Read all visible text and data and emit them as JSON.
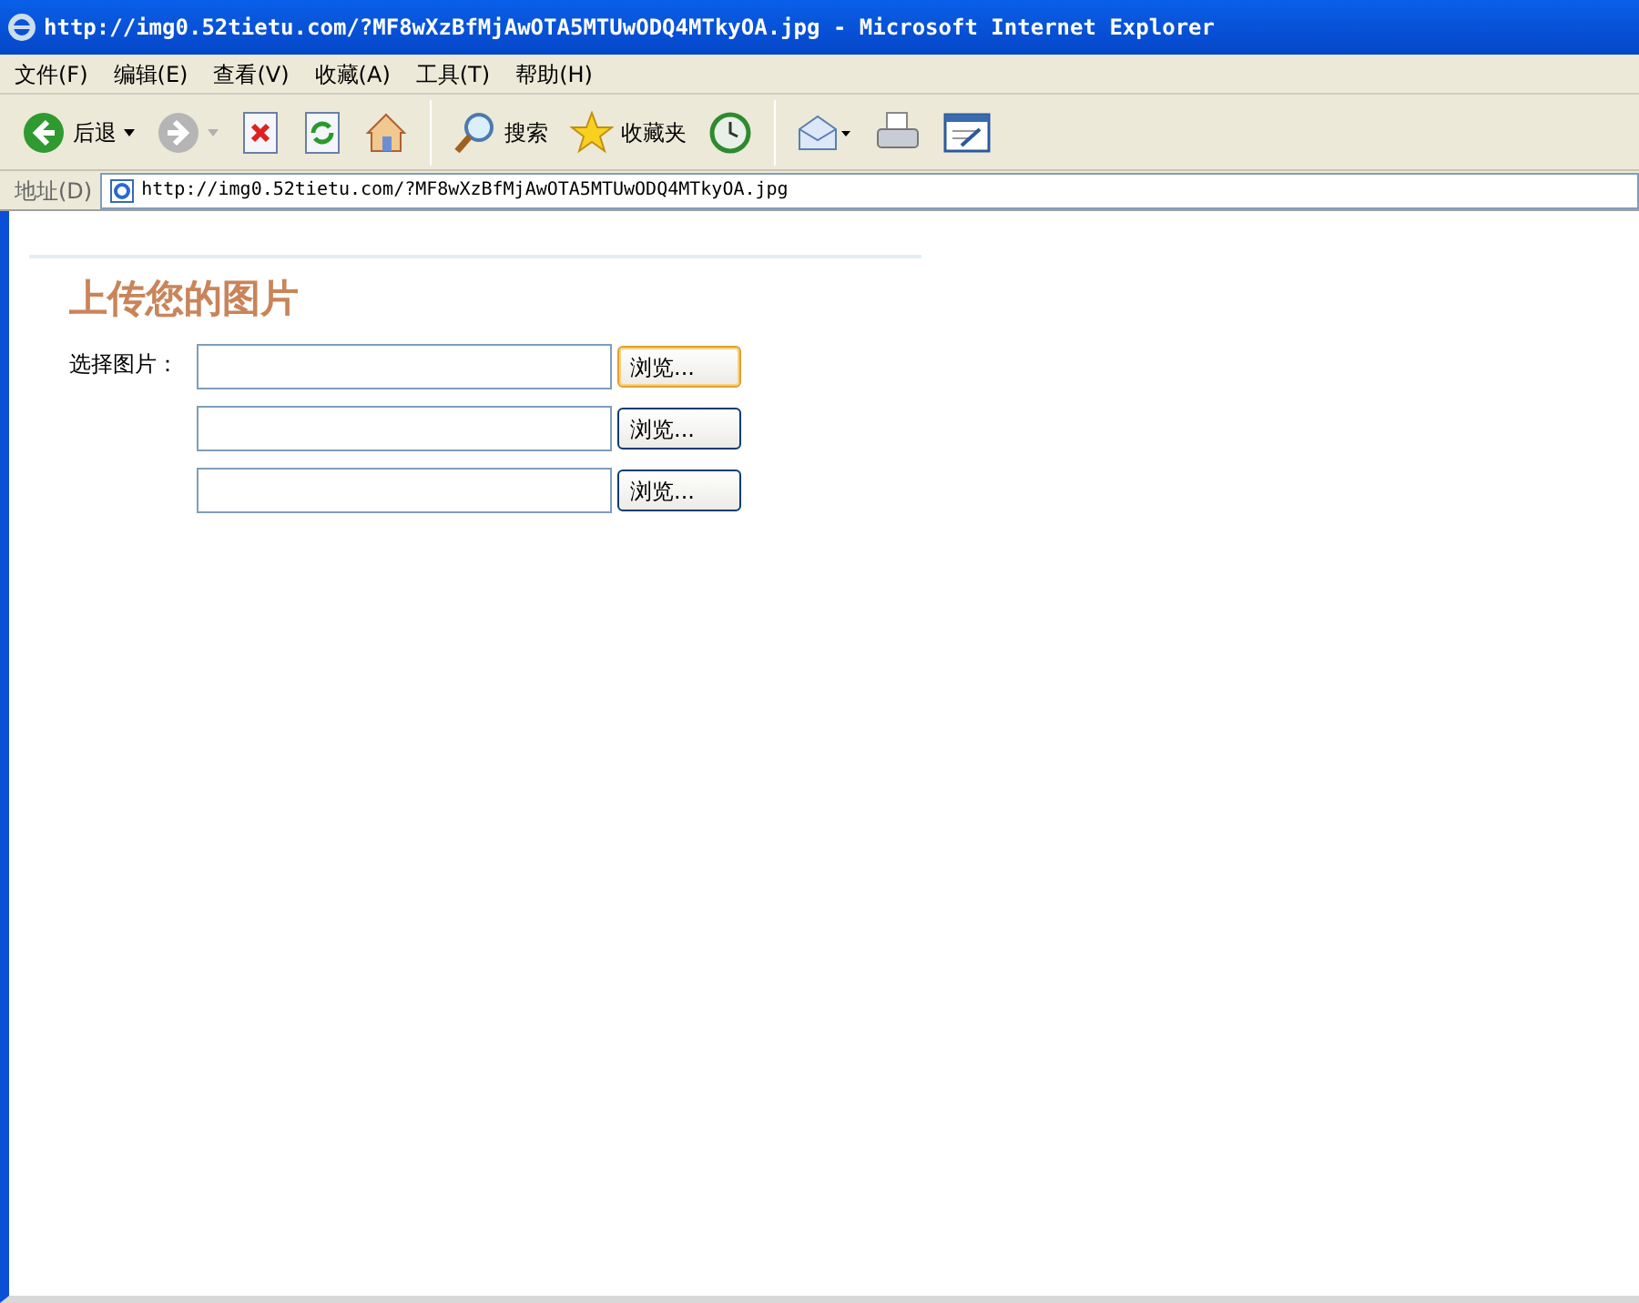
{
  "window": {
    "title": "http://img0.52tietu.com/?MF8wXzBfMjAwOTA5MTUwODQ4MTkyOA.jpg - Microsoft Internet Explorer"
  },
  "menu": [
    "文件(F)",
    "编辑(E)",
    "查看(V)",
    "收藏(A)",
    "工具(T)",
    "帮助(H)"
  ],
  "toolbar": [
    {
      "kind": "back",
      "label": "后退",
      "disabled": false
    },
    {
      "kind": "forward",
      "disabled": true
    },
    {
      "kind": "stop"
    },
    {
      "kind": "refresh"
    },
    {
      "kind": "home"
    },
    {
      "kind": "search",
      "label": "搜索"
    },
    {
      "kind": "favorites",
      "label": "收藏夹"
    },
    {
      "kind": "history"
    },
    {
      "kind": "mail"
    },
    {
      "kind": "print"
    },
    {
      "kind": "edit"
    }
  ],
  "address_bar": {
    "label": "地址(D)",
    "value": "http://img0.52tietu.com/?MF8wXzBfMjAwOTA5MTUwODQ4MTkyOA.jpg"
  },
  "page": {
    "heading": "上传您的图片",
    "field_label": "选择图片：",
    "files": [
      {
        "button": "浏览...",
        "focused": true
      },
      {
        "button": "浏览...",
        "focused": false
      },
      {
        "button": "浏览...",
        "focused": false
      }
    ]
  }
}
